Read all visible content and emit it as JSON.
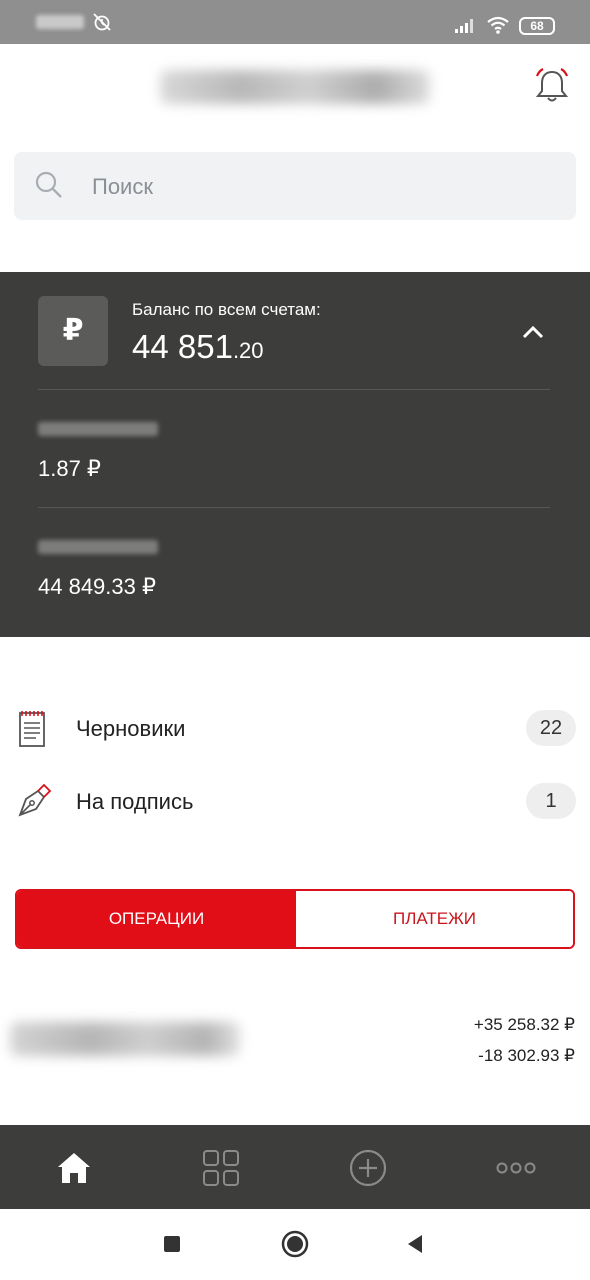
{
  "status_bar": {
    "battery": "68",
    "icons": [
      "alarm-off-icon",
      "signal-icon",
      "wifi-icon",
      "battery-icon"
    ]
  },
  "header": {
    "icons": [
      "bell-icon"
    ]
  },
  "search": {
    "placeholder": "Поиск",
    "icon": "search-icon"
  },
  "balance": {
    "currency_symbol": "₽",
    "label": "Баланс по всем счетам:",
    "total_integer": "44 851",
    "total_fraction": ".20",
    "accounts": [
      {
        "amount": "1.87 ₽"
      },
      {
        "amount": "44 849.33 ₽"
      }
    ]
  },
  "documents": [
    {
      "label": "Черновики",
      "count": "22",
      "icon": "notepad-icon"
    },
    {
      "label": "На подпись",
      "count": "1",
      "icon": "pen-icon"
    }
  ],
  "tabs": {
    "operations": "ОПЕРАЦИИ",
    "payments": "ПЛАТЕЖИ",
    "active": "operations"
  },
  "operations_summary": {
    "income": "+35 258.32 ₽",
    "expense": "-18 302.93 ₽"
  },
  "bottom_nav": [
    "home-icon",
    "grid-icon",
    "plus-circle-icon",
    "more-icon"
  ],
  "system_nav": [
    "square-icon",
    "circle-icon",
    "back-triangle-icon"
  ],
  "colors": {
    "accent": "#e10d17",
    "dark_panel": "#3d3d3b",
    "search_bg": "#f1f2f4"
  }
}
